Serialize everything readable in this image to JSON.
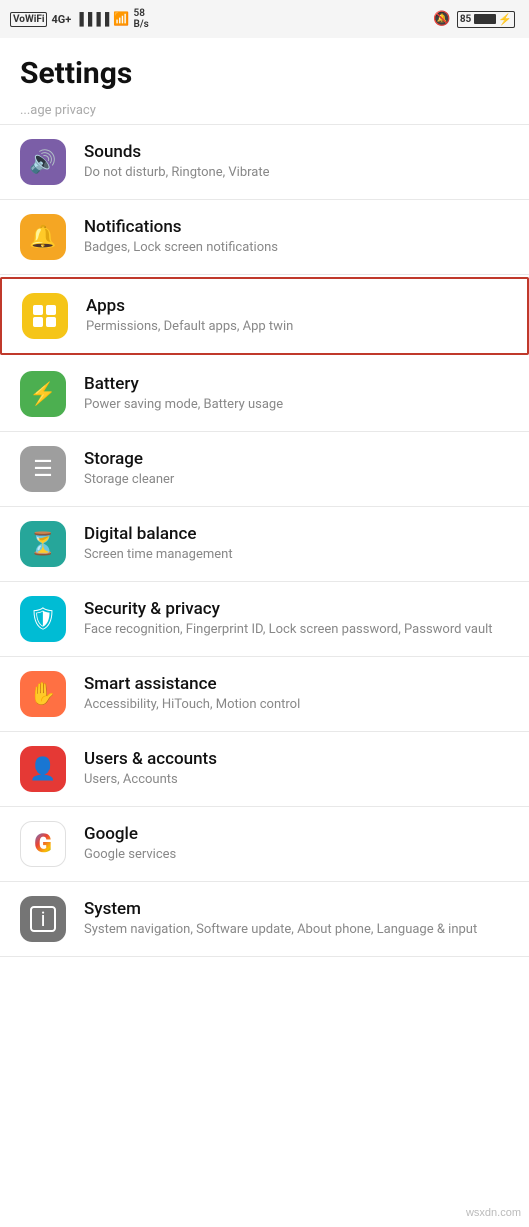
{
  "statusBar": {
    "left": {
      "vowifi": "VoWiFi",
      "network": "4G+",
      "signal": "|||",
      "wifi": "WiFi",
      "speed": "58 B/s"
    },
    "right": {
      "mute": "🔕",
      "battery": "85"
    }
  },
  "pageTitle": "Settings",
  "partialText": "...age privacy",
  "items": [
    {
      "id": "sounds",
      "title": "Sounds",
      "subtitle": "Do not disturb, Ringtone, Vibrate",
      "iconBg": "bg-purple",
      "iconSymbol": "🔊",
      "highlighted": false
    },
    {
      "id": "notifications",
      "title": "Notifications",
      "subtitle": "Badges, Lock screen notifications",
      "iconBg": "bg-orange",
      "iconSymbol": "🔔",
      "highlighted": false
    },
    {
      "id": "apps",
      "title": "Apps",
      "subtitle": "Permissions, Default apps, App twin",
      "iconBg": "bg-yellow",
      "iconSymbol": "⊞",
      "highlighted": true
    },
    {
      "id": "battery",
      "title": "Battery",
      "subtitle": "Power saving mode, Battery usage",
      "iconBg": "bg-green",
      "iconSymbol": "🔋",
      "highlighted": false
    },
    {
      "id": "storage",
      "title": "Storage",
      "subtitle": "Storage cleaner",
      "iconBg": "bg-gray",
      "iconSymbol": "▤",
      "highlighted": false
    },
    {
      "id": "digital-balance",
      "title": "Digital balance",
      "subtitle": "Screen time management",
      "iconBg": "bg-teal",
      "iconSymbol": "⧗",
      "highlighted": false
    },
    {
      "id": "security-privacy",
      "title": "Security & privacy",
      "subtitle": "Face recognition, Fingerprint ID, Lock screen password, Password vault",
      "iconBg": "bg-cyan",
      "iconSymbol": "🛡",
      "highlighted": false
    },
    {
      "id": "smart-assistance",
      "title": "Smart assistance",
      "subtitle": "Accessibility, HiTouch, Motion control",
      "iconBg": "bg-orange2",
      "iconSymbol": "✋",
      "highlighted": false
    },
    {
      "id": "users-accounts",
      "title": "Users & accounts",
      "subtitle": "Users, Accounts",
      "iconBg": "bg-red",
      "iconSymbol": "👤",
      "highlighted": false
    },
    {
      "id": "google",
      "title": "Google",
      "subtitle": "Google services",
      "iconBg": "bg-white-g",
      "iconSymbol": "G",
      "highlighted": false
    },
    {
      "id": "system",
      "title": "System",
      "subtitle": "System navigation, Software update, About phone, Language & input",
      "iconBg": "bg-darkgray",
      "iconSymbol": "ℹ",
      "highlighted": false
    }
  ],
  "watermark": "wsxdn.com"
}
